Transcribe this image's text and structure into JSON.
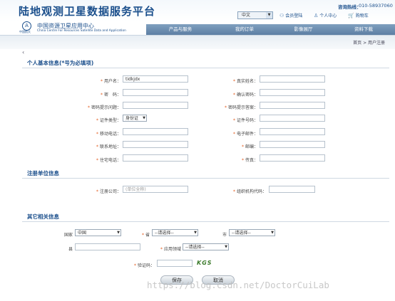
{
  "header": {
    "title": "陆地观测卫星数据服务平台",
    "hotline_label": "咨询热线：",
    "hotline_number": "010-58937060",
    "language": "中文",
    "links": {
      "member_login": "会员登陆",
      "personal_center": "个人中心",
      "cart": "购物车"
    },
    "logo_caption": "中国航天",
    "center_name_cn": "中国资源卫星应用中心",
    "center_name_en": "China Centre For Resources Satellite Data and Application"
  },
  "nav": [
    "产品与服务",
    "我的订单",
    "影像展厅",
    "资料下载"
  ],
  "breadcrumb": "首页 > 用户注册",
  "sections": {
    "personal": "个人基本信息(*号为必填项)",
    "unit": "注册单位信息",
    "other": "其它相关信息"
  },
  "personal": {
    "username_label": "用户名：",
    "username_value": "tidkjdx",
    "realname_label": "真实姓名：",
    "password_label": "密　码：",
    "confirm_label": "确认密码：",
    "question_label": "密码提示问题：",
    "answer_label": "密码提示答案：",
    "idtype_label": "证件类型：",
    "idtype_value": "身份证",
    "idnum_label": "证件号码：",
    "mobile_label": "移动电话：",
    "email_label": "电子邮件：",
    "address_label": "联系地址：",
    "postcode_label": "邮编：",
    "phone_label": "住宅电话：",
    "fax_label": "传真："
  },
  "unit": {
    "company_label": "注册公司：",
    "company_placeholder": "(单位全称)",
    "org_code_label": "组织机构代码："
  },
  "other": {
    "country_label": "国家",
    "country_value": "中国",
    "province_label": "省",
    "province_value": "--请选择--",
    "city_label": "市",
    "city_value": "--请选择--",
    "county_label": "县",
    "field_label": "应用领域",
    "field_value": "--请选择--",
    "captcha_label": "验证码：",
    "captcha_text": "KGS"
  },
  "buttons": {
    "save": "保存",
    "cancel": "取消"
  },
  "watermark": "https://blog.csdn.net/DoctorCuiLab"
}
